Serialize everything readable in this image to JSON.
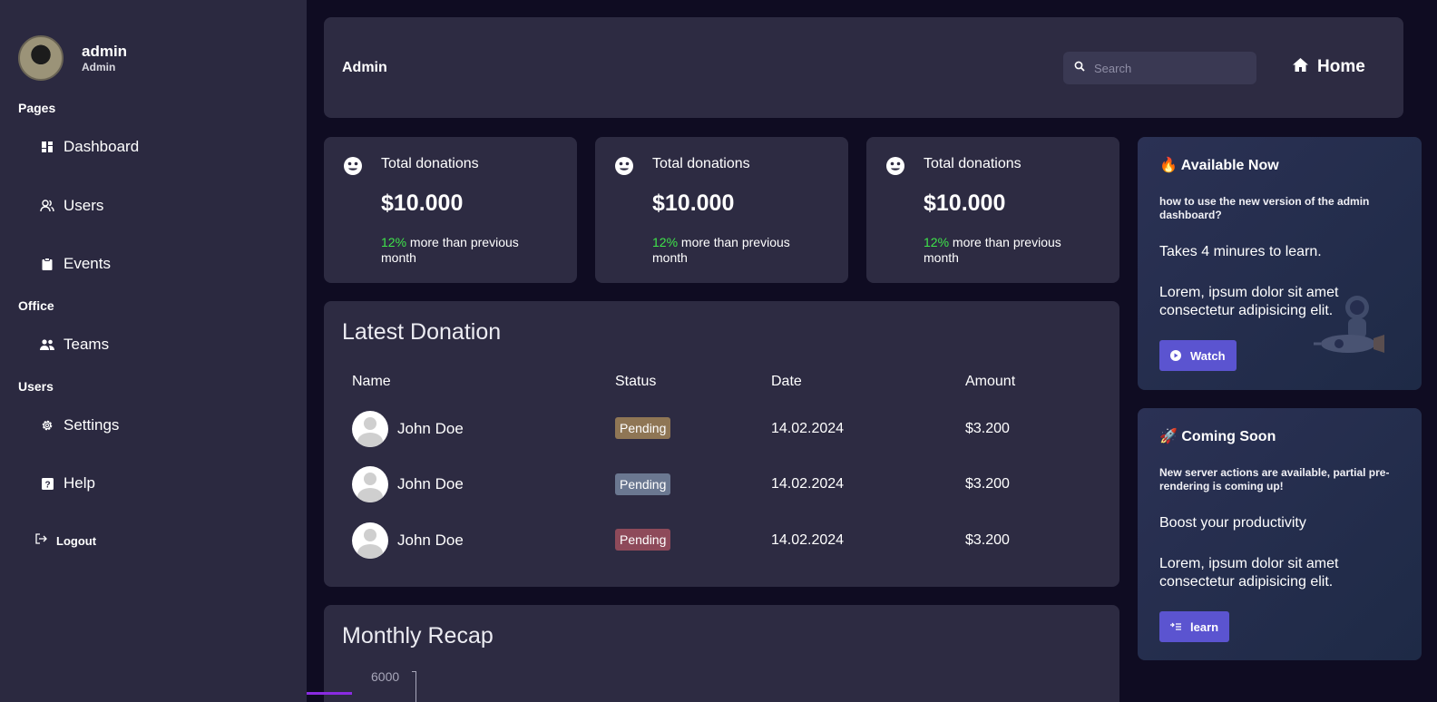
{
  "sidebar": {
    "user": {
      "name": "admin",
      "role": "Admin"
    },
    "sections": [
      {
        "title": "Pages",
        "items": [
          {
            "label": "Dashboard",
            "icon": "dashboard-icon"
          },
          {
            "label": "Users",
            "icon": "users-icon"
          },
          {
            "label": "Events",
            "icon": "clipboard-icon"
          }
        ]
      },
      {
        "title": "Office",
        "items": [
          {
            "label": "Teams",
            "icon": "teams-icon"
          }
        ]
      },
      {
        "title": "Users",
        "items": [
          {
            "label": "Settings",
            "icon": "gear-icon"
          },
          {
            "label": "Help",
            "icon": "help-icon"
          }
        ]
      }
    ],
    "logout": "Logout"
  },
  "header": {
    "title": "Admin",
    "search_placeholder": "Search",
    "home_label": "Home"
  },
  "stats": [
    {
      "title": "Total donations",
      "value": "$10.000",
      "pct": "12%",
      "note": "more than previous month"
    },
    {
      "title": "Total donations",
      "value": "$10.000",
      "pct": "12%",
      "note": "more than previous month"
    },
    {
      "title": "Total donations",
      "value": "$10.000",
      "pct": "12%",
      "note": "more than previous month"
    }
  ],
  "latest": {
    "title": "Latest Donation",
    "columns": [
      "Name",
      "Status",
      "Date",
      "Amount"
    ],
    "rows": [
      {
        "name": "John Doe",
        "status": "Pending",
        "status_color": "#8f7655",
        "date": "14.02.2024",
        "amount": "$3.200"
      },
      {
        "name": "John Doe",
        "status": "Pending",
        "status_color": "#6b7891",
        "date": "14.02.2024",
        "amount": "$3.200"
      },
      {
        "name": "John Doe",
        "status": "Pending",
        "status_color": "#8e4a5a",
        "date": "14.02.2024",
        "amount": "$3.200"
      }
    ]
  },
  "promo1": {
    "title": "🔥 Available Now",
    "subtitle": "how to use the new version of the admin dashboard?",
    "headline": "Takes 4 minures to learn.",
    "body": "Lorem, ipsum dolor sit amet consectetur adipisicing elit.",
    "button": "Watch"
  },
  "promo2": {
    "title": "🚀 Coming Soon",
    "subtitle": "New server actions are available, partial pre-rendering is coming up!",
    "headline": "Boost your productivity",
    "body": "Lorem, ipsum dolor sit amet consectetur adipisicing elit.",
    "button": "learn"
  },
  "recap": {
    "title": "Monthly Recap",
    "y_tick": "6000"
  },
  "colors": {
    "background": "#0f0c22",
    "sidebar": "#2b2940",
    "card": "#2d2b42",
    "accent_green": "#3fe54a",
    "button": "#5b54d0"
  }
}
